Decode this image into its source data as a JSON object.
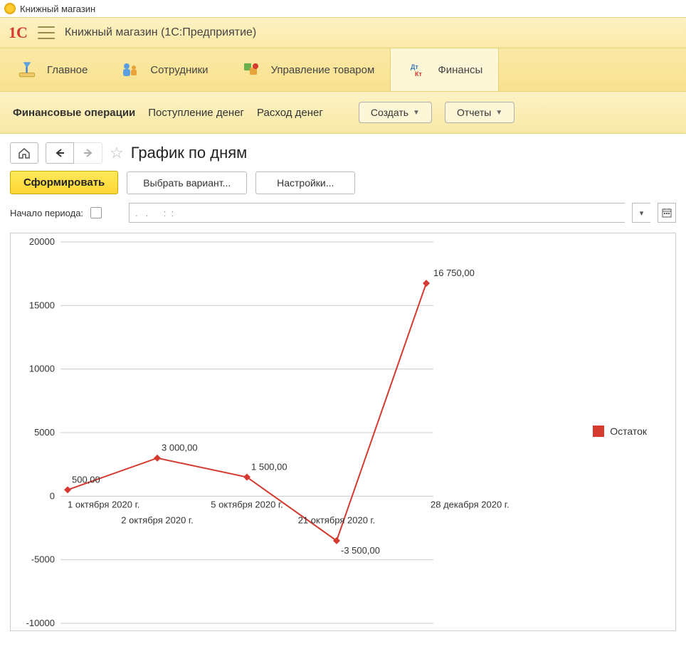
{
  "window_title": "Книжный магазин",
  "app_title": "Книжный магазин  (1С:Предприятие)",
  "nav": {
    "items": [
      {
        "label": "Главное"
      },
      {
        "label": "Сотрудники"
      },
      {
        "label": "Управление товаром"
      },
      {
        "label": "Финансы",
        "active": true
      }
    ]
  },
  "subnav": {
    "items": [
      {
        "label": "Финансовые операции",
        "bold": true
      },
      {
        "label": "Поступление денег"
      },
      {
        "label": "Расход денег"
      }
    ],
    "create_btn": "Создать",
    "reports_btn": "Отчеты"
  },
  "page_title": "График по дням",
  "actions": {
    "run": "Сформировать",
    "variant": "Выбрать вариант...",
    "settings": "Настройки..."
  },
  "period": {
    "label": "Начало периода:",
    "value": ".   .      :  :"
  },
  "legend_label": "Остаток",
  "chart_data": {
    "type": "line",
    "title": "",
    "xlabel": "",
    "ylabel": "",
    "ylim": [
      -10000,
      20000
    ],
    "yticks": [
      -10000,
      -5000,
      0,
      5000,
      10000,
      15000,
      20000
    ],
    "series": [
      {
        "name": "Остаток",
        "color": "#d43a2f",
        "points": [
          {
            "x_label": "1 октября 2020 г.",
            "value": 500.0,
            "label": "500,00",
            "x_label_offset": 0
          },
          {
            "x_label": "2 октября 2020 г.",
            "value": 3000.0,
            "label": "3 000,00",
            "x_label_offset": 1
          },
          {
            "x_label": "5 октября 2020 г.",
            "value": 1500.0,
            "label": "1 500,00",
            "x_label_offset": 0
          },
          {
            "x_label": "21 октября 2020 г.",
            "value": -3500.0,
            "label": "-3 500,00",
            "x_label_offset": 1
          },
          {
            "x_label": "28 декабря 2020 г.",
            "value": 16750.0,
            "label": "16 750,00",
            "x_label_offset": 0
          }
        ]
      }
    ]
  }
}
